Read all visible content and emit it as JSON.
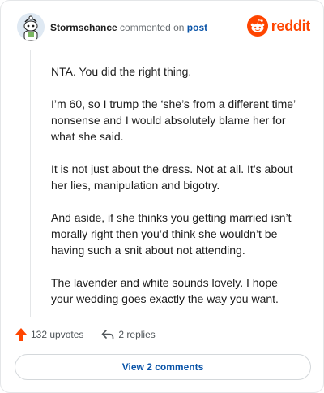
{
  "comment": {
    "username": "Stormschance",
    "action_text": "commented on",
    "post_link": "post",
    "paragraphs": [
      "NTA. You did the right thing.",
      "I’m 60, so I trump the ‘she’s from a different time’ nonsense and I would absolutely blame her for what she said.",
      "It is not just about the dress. Not at all. It’s about her lies, manipulation and bigotry.",
      "And aside, if she thinks you getting married isn’t morally right then you’d think she wouldn’t be having such a snit about not attending.",
      "The lavender and white sounds lovely. I hope your wedding goes exactly the way you want."
    ]
  },
  "brand": {
    "wordmark": "reddit",
    "color": "#ff4500"
  },
  "actions": {
    "upvotes": "132 upvotes",
    "replies": "2 replies"
  },
  "footer": {
    "view_comments": "View 2 comments"
  },
  "icons": {
    "avatar": "snoo-avatar-icon",
    "brand": "reddit-logo-icon",
    "upvote": "upvote-arrow-icon",
    "reply": "reply-arrow-icon"
  },
  "colors": {
    "link": "#0a54a8",
    "upvote": "#ff4500",
    "text": "#1c1c1c",
    "muted": "#6a6f73"
  }
}
